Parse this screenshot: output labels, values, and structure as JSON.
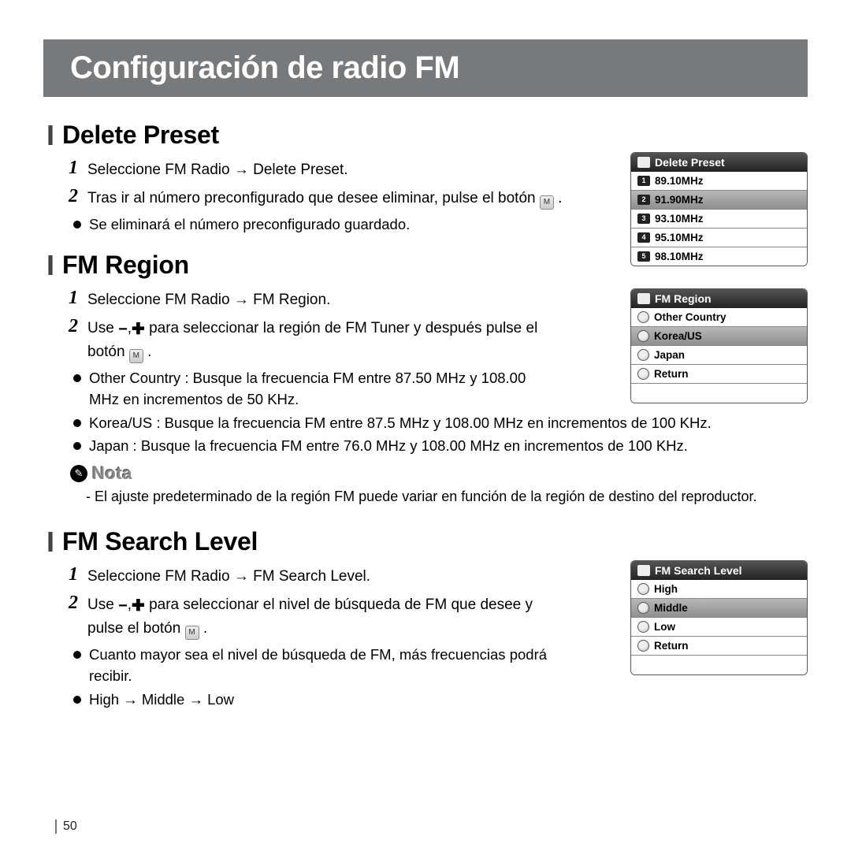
{
  "page": {
    "title": "Configuración de radio FM",
    "number": "50"
  },
  "sections": {
    "deletePreset": {
      "title": "Delete Preset",
      "step1": "Seleccione FM Radio → Delete Preset.",
      "step2_pre": "Tras ir al número preconfigurado que desee eliminar, pulse el botón ",
      "step2_post": " .",
      "bullet1": "Se eliminará el número preconfigurado guardado."
    },
    "fmRegion": {
      "title": "FM Region",
      "step1": "Seleccione FM Radio → FM Region.",
      "step2_pre": "Use ",
      "step2_mid": " para seleccionar la región de FM Tuner y después pulse el botón ",
      "step2_post": " .",
      "bullet1": "Other Country : Busque la frecuencia FM entre 87.50 MHz y 108.00 MHz en incrementos de 50 KHz.",
      "bullet2": "Korea/US : Busque la frecuencia FM entre 87.5 MHz y 108.00 MHz en incrementos de 100 KHz.",
      "bullet3": "Japan : Busque la frecuencia FM entre 76.0 MHz y 108.00 MHz en incrementos de 100 KHz.",
      "noteLabel": "Nota",
      "noteText": "- El ajuste predeterminado de la región FM puede variar en función de la región de destino del reproductor."
    },
    "fmSearch": {
      "title": "FM Search Level",
      "step1": "Seleccione FM Radio → FM Search Level.",
      "step2_pre": "Use ",
      "step2_mid": " para seleccionar el nivel de búsqueda de FM que desee y pulse el botón ",
      "step2_post": " .",
      "bullet1": "Cuanto mayor sea el nivel de búsqueda de FM, más frecuencias podrá recibir.",
      "bullet2": "High → Middle → Low"
    }
  },
  "screens": {
    "deletePreset": {
      "header": "Delete Preset",
      "items": [
        "89.10MHz",
        "91.90MHz",
        "93.10MHz",
        "95.10MHz",
        "98.10MHz"
      ],
      "selectedIndex": 1
    },
    "fmRegion": {
      "header": "FM Region",
      "items": [
        "Other Country",
        "Korea/US",
        "Japan",
        "Return"
      ],
      "selectedIndex": 1
    },
    "fmSearch": {
      "header": "FM Search Level",
      "items": [
        "High",
        "Middle",
        "Low",
        "Return"
      ],
      "selectedIndex": 1
    }
  }
}
